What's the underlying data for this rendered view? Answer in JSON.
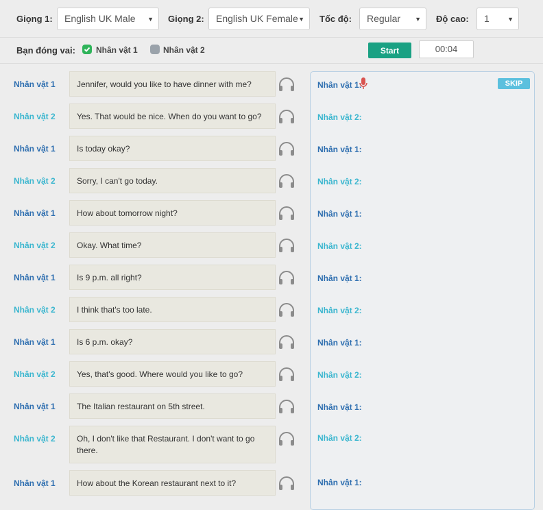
{
  "controls": {
    "voice1_label": "Giọng 1:",
    "voice1_value": "English UK Male",
    "voice2_label": "Giọng 2:",
    "voice2_value": "English UK Female",
    "speed_label": "Tốc độ:",
    "speed_value": "Regular",
    "pitch_label": "Độ cao:",
    "pitch_value": "1"
  },
  "role": {
    "label": "Bạn đóng vai:",
    "option1": "Nhân vật 1",
    "option1_checked": true,
    "option2": "Nhân vật 2",
    "option2_checked": false,
    "start_label": "Start",
    "timer": "00:04"
  },
  "dialogue": [
    {
      "speaker": "Nhân vật 1",
      "text": "Jennifer, would you like to have dinner with me?"
    },
    {
      "speaker": "Nhân vật 2",
      "text": "Yes. That would be nice. When do you want to go?"
    },
    {
      "speaker": "Nhân vật 1",
      "text": "Is today okay?"
    },
    {
      "speaker": "Nhân vật 2",
      "text": "Sorry, I can't go today."
    },
    {
      "speaker": "Nhân vật 1",
      "text": "How about tomorrow night?"
    },
    {
      "speaker": "Nhân vật 2",
      "text": "Okay. What time?"
    },
    {
      "speaker": "Nhân vật 1",
      "text": "Is 9 p.m. all right?"
    },
    {
      "speaker": "Nhân vật 2",
      "text": "I think that's too late."
    },
    {
      "speaker": "Nhân vật 1",
      "text": "Is 6 p.m. okay?"
    },
    {
      "speaker": "Nhân vật 2",
      "text": "Yes, that's good. Where would you like to go?"
    },
    {
      "speaker": "Nhân vật 1",
      "text": "The Italian restaurant on 5th street."
    },
    {
      "speaker": "Nhân vật 2",
      "text": "Oh, I don't like that Restaurant. I don't want to go there."
    },
    {
      "speaker": "Nhân vật 1",
      "text": "How about the Korean restaurant next to it?"
    }
  ],
  "panel": {
    "skip_label": "SKIP",
    "lines": [
      "Nhân vật 1:",
      "Nhân vật 2:",
      "Nhân vật 1:",
      "Nhân vật 2:",
      "Nhân vật 1:",
      "Nhân vật 2:",
      "Nhân vật 1:",
      "Nhân vật 2:",
      "Nhân vật 1:",
      "Nhân vật 2:",
      "Nhân vật 1:",
      "Nhân vật 2:",
      "Nhân vật 1:"
    ]
  },
  "icons": {
    "headphones": "headphones-icon",
    "mic": "microphone-icon",
    "check": "check-icon",
    "caret": "chevron-down-icon"
  },
  "colors": {
    "speaker1": "#2f6fb0",
    "speaker2": "#3bb6cf",
    "start_button": "#1aa183",
    "skip_button": "#5bc0de",
    "mic": "#d9534f"
  }
}
